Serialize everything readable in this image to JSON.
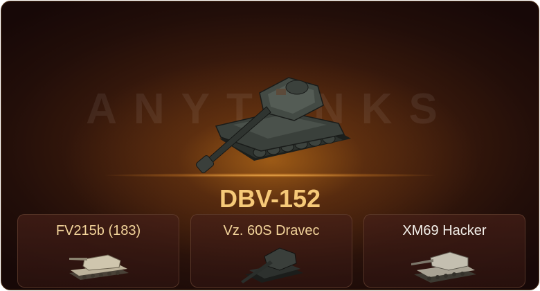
{
  "watermark": "ANYTANKS",
  "featured": {
    "name": "DBV-152",
    "image_icon": "tank-icon",
    "name_color": "#f6c978"
  },
  "options": [
    {
      "label": "FV215b (183)",
      "icon": "tank-icon",
      "label_color": "#f2d39a"
    },
    {
      "label": "Vz. 60S Dravec",
      "icon": "tank-icon",
      "label_color": "#f2d39a"
    },
    {
      "label": "XM69 Hacker",
      "icon": "tank-icon",
      "label_color": "#f4f0ea"
    }
  ],
  "colors": {
    "background": "#2a120b",
    "glow": "#d6821c",
    "card_border": "#5a3b22"
  }
}
